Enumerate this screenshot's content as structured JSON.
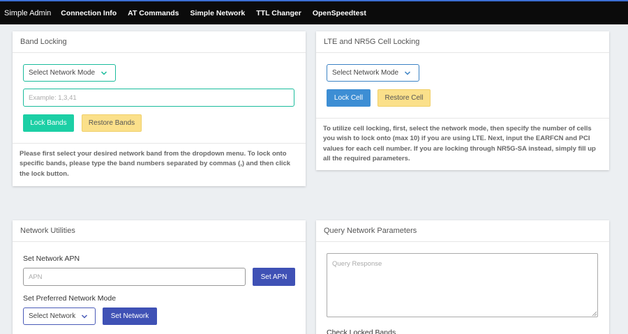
{
  "navbar": {
    "brand": "Simple Admin",
    "links": [
      "Connection Info",
      "AT Commands",
      "Simple Network",
      "TTL Changer",
      "OpenSpeedtest"
    ]
  },
  "band_locking": {
    "title": "Band Locking",
    "network_mode_select": "Select Network Mode",
    "bands_placeholder": "Example: 1,3,41",
    "lock_button": "Lock Bands",
    "restore_button": "Restore Bands",
    "help_text": "Please first select your desired network band from the dropdown menu. To lock onto specific bands, please type the band numbers separated by commas (,) and then click the lock button."
  },
  "cell_locking": {
    "title": "LTE and NR5G Cell Locking",
    "network_mode_select": "Select Network Mode",
    "lock_button": "Lock Cell",
    "restore_button": "Restore Cell",
    "help_text": "To utilize cell locking, first, select the network mode, then specify the number of cells you wish to lock onto (max 10) if you are using LTE. Next, input the EARFCN and PCI values for each cell number. If you are locking through NR5G-SA instead, simply fill up all the required parameters."
  },
  "network_utilities": {
    "title": "Network Utilities",
    "apn_label": "Set Network APN",
    "apn_placeholder": "APN",
    "apn_button": "Set APN",
    "mode_label": "Set Preferred Network Mode",
    "mode_select": "Select Network",
    "mode_button": "Set Network"
  },
  "query_parameters": {
    "title": "Query Network Parameters",
    "response_placeholder": "Query Response",
    "check_bands_label": "Check Locked Bands"
  },
  "colors": {
    "navbar_bg": "#0b0b0b",
    "accent_teal": "#1ccfa5",
    "accent_yellow": "#fbe08a",
    "accent_blue": "#3d8ed4",
    "accent_indigo": "#3f51b5"
  }
}
